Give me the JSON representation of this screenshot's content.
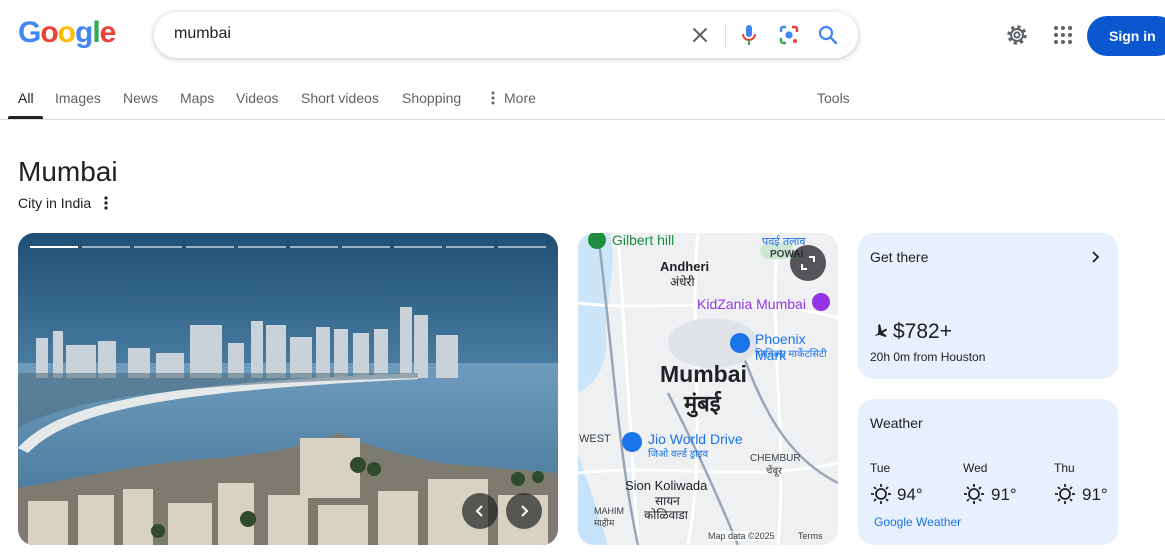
{
  "header": {
    "logo_letters": [
      "G",
      "o",
      "o",
      "g",
      "l",
      "e"
    ],
    "logo_colors": [
      "#4285f4",
      "#ea4335",
      "#fbbc05",
      "#4285f4",
      "#34a853",
      "#ea4335"
    ],
    "query": "mumbai",
    "signin_label": "Sign in"
  },
  "tabs": [
    "All",
    "Images",
    "News",
    "Maps",
    "Videos",
    "Short videos",
    "Shopping",
    "More"
  ],
  "tools_label": "Tools",
  "entity": {
    "title": "Mumbai",
    "subtitle": "City in India"
  },
  "map": {
    "labels": {
      "gilbert": "Gilbert hill",
      "powai_dev": "पवई तलाव",
      "powai": "POWAI",
      "andheri": "Andheri",
      "andheri_dev": "अंधेरी",
      "kidzania": "KidZania Mumbai",
      "phoenix": "Phoenix Mark",
      "phoenix_dev": "फिनिक्स मार्केटसिटी",
      "city": "Mumbai",
      "city_dev": "मुंबई",
      "west": "WEST",
      "jio": "Jio World Drive",
      "jio_dev": "जिओ वर्ल्ड ड्राइव",
      "chembur": "CHEMBUR",
      "chembur_dev": "चेंबूर",
      "sion": "Sion Koliwada",
      "sion_dev1": "सायन",
      "sion_dev2": "कोळिवाडा",
      "mahim": "MAHIM",
      "mahim_dev": "माहीम",
      "mapdata": "Map data ©2025",
      "terms": "Terms"
    }
  },
  "get_there": {
    "title": "Get there",
    "price": "$782+",
    "duration": "20h 0m from Houston"
  },
  "weather": {
    "title": "Weather",
    "days": [
      {
        "day": "Tue",
        "temp": "94°"
      },
      {
        "day": "Wed",
        "temp": "91°"
      },
      {
        "day": "Thu",
        "temp": "91°"
      }
    ],
    "source": "Google Weather"
  }
}
